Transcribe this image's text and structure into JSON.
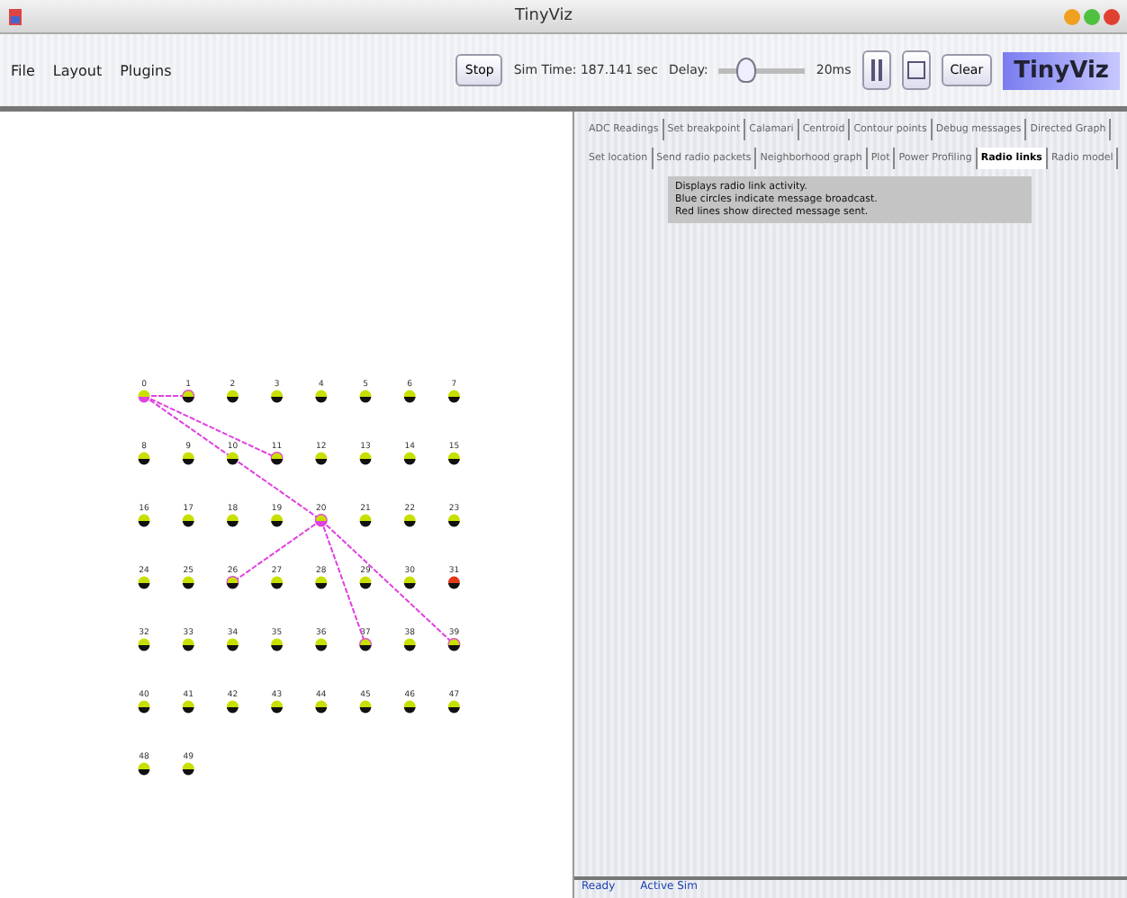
{
  "window": {
    "title": "TinyViz"
  },
  "menu": [
    {
      "label": "File"
    },
    {
      "label": "Layout"
    },
    {
      "label": "Plugins"
    }
  ],
  "toolbar": {
    "stop_button": "Stop",
    "sim_time": "Sim Time: 187.141 sec",
    "delay_label": "Delay:",
    "delay": {
      "level": 0.3
    },
    "delay_reading": "20ms",
    "clear_button": "Clear",
    "logo": "TinyViz"
  },
  "motes": [
    {
      "label": "0",
      "color": "#c8e000",
      "sender": true,
      "linked": false
    },
    {
      "label": "1",
      "color": "#c8e000",
      "sender": false,
      "linked": true
    },
    {
      "label": "2",
      "color": "#c8e000",
      "sender": false,
      "linked": false
    },
    {
      "label": "3",
      "color": "#c8e000",
      "sender": false,
      "linked": false
    },
    {
      "label": "4",
      "color": "#c8e000",
      "sender": false,
      "linked": false
    },
    {
      "label": "5",
      "color": "#c8e000",
      "sender": false,
      "linked": false
    },
    {
      "label": "6",
      "color": "#c8e000",
      "sender": false,
      "linked": false
    },
    {
      "label": "7",
      "color": "#c8e000",
      "sender": false,
      "linked": false
    },
    {
      "label": "8",
      "color": "#c8e000",
      "sender": false,
      "linked": false
    },
    {
      "label": "9",
      "color": "#c8e000",
      "sender": false,
      "linked": false
    },
    {
      "label": "10",
      "color": "#c8e000",
      "sender": false,
      "linked": false
    },
    {
      "label": "11",
      "color": "#c8e000",
      "sender": false,
      "linked": true
    },
    {
      "label": "12",
      "color": "#c8e000",
      "sender": false,
      "linked": false
    },
    {
      "label": "13",
      "color": "#c8e000",
      "sender": false,
      "linked": false
    },
    {
      "label": "14",
      "color": "#c8e000",
      "sender": false,
      "linked": false
    },
    {
      "label": "15",
      "color": "#c8e000",
      "sender": false,
      "linked": false
    },
    {
      "label": "16",
      "color": "#c8e000",
      "sender": false,
      "linked": false
    },
    {
      "label": "17",
      "color": "#c8e000",
      "sender": false,
      "linked": false
    },
    {
      "label": "18",
      "color": "#c8e000",
      "sender": false,
      "linked": false
    },
    {
      "label": "19",
      "color": "#c8e000",
      "sender": false,
      "linked": false
    },
    {
      "label": "20",
      "color": "#c8e000",
      "sender": true,
      "linked": true
    },
    {
      "label": "21",
      "color": "#c8e000",
      "sender": false,
      "linked": false
    },
    {
      "label": "22",
      "color": "#c8e000",
      "sender": false,
      "linked": false
    },
    {
      "label": "23",
      "color": "#c8e000",
      "sender": false,
      "linked": false
    },
    {
      "label": "24",
      "color": "#c8e000",
      "sender": false,
      "linked": false
    },
    {
      "label": "25",
      "color": "#c8e000",
      "sender": false,
      "linked": false
    },
    {
      "label": "26",
      "color": "#c8e000",
      "sender": false,
      "linked": true
    },
    {
      "label": "27",
      "color": "#c8e000",
      "sender": false,
      "linked": false
    },
    {
      "label": "28",
      "color": "#c8e000",
      "sender": false,
      "linked": false
    },
    {
      "label": "29",
      "color": "#c8e000",
      "sender": false,
      "linked": false
    },
    {
      "label": "30",
      "color": "#c8e000",
      "sender": false,
      "linked": false
    },
    {
      "label": "31",
      "color": "#e03a1a",
      "sender": false,
      "linked": false
    },
    {
      "label": "32",
      "color": "#c8e000",
      "sender": false,
      "linked": false
    },
    {
      "label": "33",
      "color": "#c8e000",
      "sender": false,
      "linked": false
    },
    {
      "label": "34",
      "color": "#c8e000",
      "sender": false,
      "linked": false
    },
    {
      "label": "35",
      "color": "#c8e000",
      "sender": false,
      "linked": false
    },
    {
      "label": "36",
      "color": "#c8e000",
      "sender": false,
      "linked": false
    },
    {
      "label": "37",
      "color": "#c8e000",
      "sender": false,
      "linked": true
    },
    {
      "label": "38",
      "color": "#c8e000",
      "sender": false,
      "linked": false
    },
    {
      "label": "39",
      "color": "#c8e000",
      "sender": false,
      "linked": true
    },
    {
      "label": "40",
      "color": "#c8e000",
      "sender": false,
      "linked": false
    },
    {
      "label": "41",
      "color": "#c8e000",
      "sender": false,
      "linked": false
    },
    {
      "label": "42",
      "color": "#c8e000",
      "sender": false,
      "linked": false
    },
    {
      "label": "43",
      "color": "#c8e000",
      "sender": false,
      "linked": false
    },
    {
      "label": "44",
      "color": "#c8e000",
      "sender": false,
      "linked": false
    },
    {
      "label": "45",
      "color": "#c8e000",
      "sender": false,
      "linked": false
    },
    {
      "label": "46",
      "color": "#c8e000",
      "sender": false,
      "linked": false
    },
    {
      "label": "47",
      "color": "#c8e000",
      "sender": false,
      "linked": false
    },
    {
      "label": "48",
      "color": "#c8e000",
      "sender": false,
      "linked": false
    },
    {
      "label": "49",
      "color": "#c8e000",
      "sender": false,
      "linked": false
    }
  ],
  "plugin_tabs": [
    [
      {
        "label": "ADC Readings",
        "selected": false
      },
      {
        "label": "Set breakpoint",
        "selected": false
      },
      {
        "label": "Calamari",
        "selected": false
      },
      {
        "label": "Centroid",
        "selected": false
      },
      {
        "label": "Contour points",
        "selected": false
      },
      {
        "label": "Debug messages",
        "selected": false
      },
      {
        "label": "Directed Graph",
        "selected": false
      }
    ],
    [
      {
        "label": "Set location",
        "selected": false
      },
      {
        "label": "Send radio packets",
        "selected": false
      },
      {
        "label": "Neighborhood graph",
        "selected": false
      },
      {
        "label": "Plot",
        "selected": false
      },
      {
        "label": "Power Profiling",
        "selected": false
      },
      {
        "label": "Radio links",
        "selected": true
      },
      {
        "label": "Radio model",
        "selected": false
      }
    ]
  ],
  "plugin_info": [
    "Displays radio link activity.",
    "Blue circles indicate message broadcast.",
    "Red lines show directed message sent."
  ],
  "status_bar": [
    "Ready",
    "Active Sim"
  ]
}
